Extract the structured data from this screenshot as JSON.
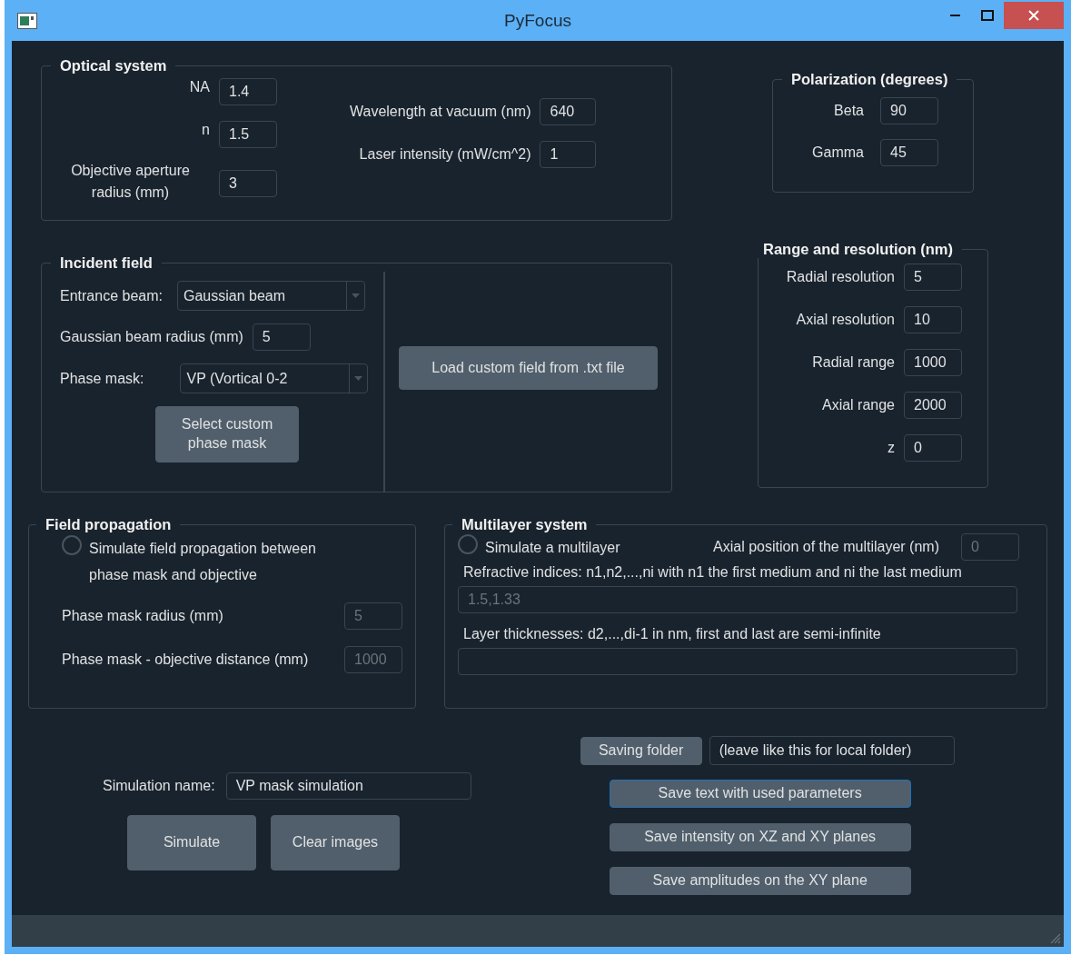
{
  "window": {
    "title": "PyFocus"
  },
  "optical_system": {
    "title": "Optical system",
    "fields_left": [
      {
        "label": "NA",
        "value": "1.4"
      },
      {
        "label": "n",
        "value": "1.5"
      },
      {
        "label": "Objective aperture radius (mm)",
        "value": "3"
      }
    ],
    "fields_right": [
      {
        "label": "Wavelength at vacuum (nm)",
        "value": "640"
      },
      {
        "label": "Laser intensity (mW/cm^2)",
        "value": "1"
      }
    ]
  },
  "polarization": {
    "title": "Polarization (degrees)",
    "fields": [
      {
        "label": "Beta",
        "value": "90"
      },
      {
        "label": "Gamma",
        "value": "45"
      }
    ]
  },
  "incident_field": {
    "title": "Incident field",
    "entrance_beam": {
      "label": "Entrance beam:",
      "value": "Gaussian beam"
    },
    "beam_radius": {
      "label": "Gaussian beam radius (mm)",
      "value": "5"
    },
    "phase_mask": {
      "label": "Phase mask:",
      "value": "VP (Vortical 0-2"
    },
    "select_mask_button": "Select custom phase mask",
    "load_button": "Load custom field from .txt file"
  },
  "range": {
    "title": "Range and resolution (nm)",
    "fields": [
      {
        "label": "Radial resolution",
        "value": "5"
      },
      {
        "label": "Axial resolution",
        "value": "10"
      },
      {
        "label": "Radial range",
        "value": "1000"
      },
      {
        "label": "Axial range",
        "value": "2000"
      },
      {
        "label": "z",
        "value": "0"
      }
    ]
  },
  "field_propagation": {
    "title": "Field propagation",
    "option": {
      "label": "Simulate field propagation between phase mask and objective",
      "checked": false
    },
    "fields": [
      {
        "label": "Phase mask radius (mm)",
        "value": "5",
        "disabled": true
      },
      {
        "label": "Phase mask - objective distance (mm)",
        "value": "1000",
        "disabled": true
      }
    ]
  },
  "multilayer": {
    "title": "Multilayer system",
    "option": {
      "label": "Simulate a multilayer",
      "checked": false
    },
    "axial_position": {
      "label": "Axial position of the multilayer (nm)",
      "value": "0",
      "disabled": true
    },
    "refractive_indices": {
      "label": "Refractive indices: n1,n2,...,ni with n1 the first medium and ni the last medium",
      "value": "1.5,1.33",
      "disabled": true
    },
    "thicknesses": {
      "label": "Layer thicknesses: d2,...,di-1 in nm, first and last are semi-infinite"
    }
  },
  "simulation": {
    "label": "Simulation name:",
    "value": "VP mask simulation",
    "buttons": [
      "Simulate",
      "Clear images"
    ]
  },
  "saving": {
    "folder_button": "Saving folder",
    "folder_value": "(leave like this for local folder)",
    "buttons": [
      {
        "label": "Save text with used parameters",
        "focused": true
      },
      {
        "label": "Save intensity on XZ and XY planes",
        "focused": false
      },
      {
        "label": "Save amplitudes on the XY plane",
        "focused": false
      }
    ]
  }
}
